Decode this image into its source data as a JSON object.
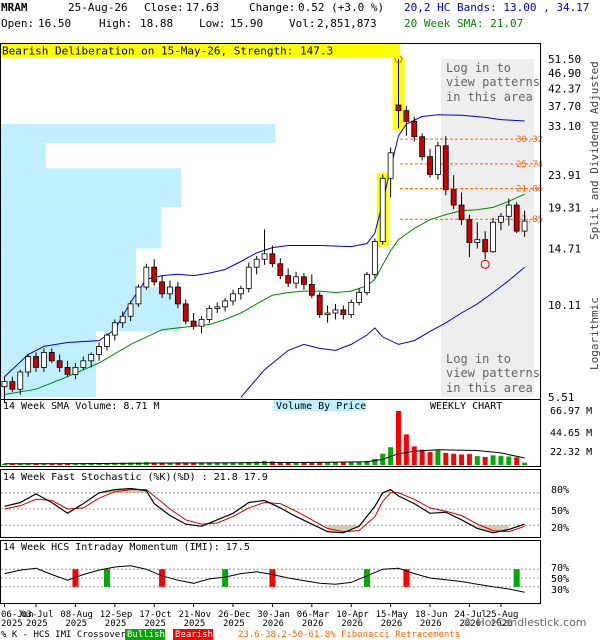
{
  "header": {
    "ticker": "MRAM",
    "date": "25-Aug-26",
    "close_label": "Close:",
    "close_value": "17.63",
    "change_label": "Change:",
    "change_value": "0.52 (+3.0 %)",
    "open_label": "Open:",
    "open_value": "16.50",
    "high_label": "High:",
    "high_value": "18.88",
    "low_label": "Low:",
    "low_value": "15.90",
    "vol_label": "Vol:",
    "vol_value": "2,851,873",
    "hc_bands_label": "20,2 HC Bands: 13.00 , 34.17",
    "sma_label": "20 Week SMA: 21.07"
  },
  "watermark": "© HotCandlestick.com",
  "price_panel": {
    "banner": "Bearish Deliberation on 15-May-26, Strength: 147.3",
    "login_text_top": [
      "Log in to",
      "view patterns",
      "in this area"
    ],
    "login_text_bottom": [
      "Log in to",
      "view patterns",
      "in this area"
    ],
    "y_axis_labels": [
      "51.50",
      "46.90",
      "42.37",
      "37.70",
      "33.10",
      "23.91",
      "19.31",
      "14.71",
      "10.11",
      "5.51"
    ],
    "fib_labels": [
      "30.32",
      "25.74",
      "21.86",
      "17.85"
    ],
    "side_label_top": "Split and Dividend Adjusted",
    "side_label_bottom": "Logarithmic"
  },
  "volume_panel": {
    "sma_label": "14 Week SMA Volume: 8.71 M",
    "vbp_label": "Volume By Price",
    "weekly_label": "WEEKLY CHART",
    "y_labels": [
      "66.97 M",
      "44.65 M",
      "22.32 M"
    ]
  },
  "stoch_panel": {
    "title": "14 Week Fast Stochastic (%K)(%D) : 21.8  17.9",
    "y_labels": [
      "80%",
      "50%",
      "20%"
    ]
  },
  "imi_panel": {
    "title": "14 Week HCS Intraday Momentum (IMI): 17.5",
    "y_labels": [
      "70%",
      "50%",
      "30%"
    ]
  },
  "x_axis": {
    "dates": [
      "06-Jun",
      "03-Jul",
      "08-Aug",
      "12-Sep",
      "17-Oct",
      "21-Nov",
      "26-Dec",
      "30-Jan",
      "06-Mar",
      "10-Apr",
      "15-May",
      "18-Jun",
      "24-Jul",
      "25-Aug"
    ],
    "years": [
      "2025",
      "2025",
      "2025",
      "2025",
      "2025",
      "2025",
      "2025",
      "2026",
      "2026",
      "2026",
      "2026",
      "2026",
      "2026",
      "2026"
    ]
  },
  "footer": {
    "legend_prefix": "% K - HCS IMI Crossover,",
    "bullish": "Bullish",
    "bearish": "Bearish",
    "fib_text": "23.6-38.2-50-61.8% Fibonacci Retracements"
  },
  "colors": {
    "bull": "#00aa00",
    "bear": "#ff0000",
    "upper_band": "#0000cc",
    "sma": "#008800",
    "fib": "#ff6600",
    "vbp": "#c0f0ff",
    "banner": "#ffff00"
  },
  "chart_data": {
    "type": "candlestick",
    "timeframe": "weekly",
    "scale": "log",
    "ylim": [
      5.51,
      51.5
    ],
    "candles": [
      [
        5.9,
        6.3,
        5.3,
        6.1
      ],
      [
        6.1,
        6.3,
        5.7,
        5.8
      ],
      [
        5.8,
        6.6,
        5.6,
        6.5
      ],
      [
        6.5,
        7.3,
        6.3,
        7.2
      ],
      [
        7.2,
        7.4,
        6.5,
        6.7
      ],
      [
        6.7,
        7.6,
        6.5,
        7.4
      ],
      [
        7.4,
        7.6,
        6.9,
        7.0
      ],
      [
        7.0,
        7.3,
        6.5,
        6.7
      ],
      [
        6.7,
        7.0,
        6.3,
        6.4
      ],
      [
        6.4,
        6.9,
        6.2,
        6.7
      ],
      [
        6.7,
        7.2,
        6.6,
        7.0
      ],
      [
        7.0,
        7.4,
        6.7,
        7.3
      ],
      [
        7.3,
        7.9,
        7.0,
        7.7
      ],
      [
        7.7,
        8.4,
        7.5,
        8.3
      ],
      [
        8.3,
        9.2,
        8.0,
        9.0
      ],
      [
        9.0,
        9.7,
        8.7,
        9.4
      ],
      [
        9.4,
        10.4,
        9.1,
        10.2
      ],
      [
        10.2,
        11.6,
        10.0,
        11.4
      ],
      [
        11.4,
        13.3,
        11.2,
        13.0
      ],
      [
        13.0,
        13.7,
        11.5,
        11.8
      ],
      [
        11.8,
        12.3,
        10.6,
        10.9
      ],
      [
        10.9,
        11.9,
        10.5,
        11.4
      ],
      [
        11.4,
        11.8,
        9.9,
        10.2
      ],
      [
        10.2,
        10.5,
        8.9,
        9.1
      ],
      [
        9.1,
        9.6,
        8.6,
        8.8
      ],
      [
        8.8,
        9.4,
        8.4,
        9.2
      ],
      [
        9.2,
        10.1,
        9.0,
        9.9
      ],
      [
        9.9,
        10.3,
        9.6,
        10.0
      ],
      [
        10.0,
        10.6,
        9.7,
        10.4
      ],
      [
        10.4,
        11.2,
        10.1,
        10.9
      ],
      [
        10.9,
        11.5,
        10.5,
        11.3
      ],
      [
        11.3,
        13.4,
        11.0,
        13.0
      ],
      [
        13.0,
        14.0,
        12.4,
        13.7
      ],
      [
        13.7,
        16.7,
        13.2,
        14.2
      ],
      [
        14.2,
        15.0,
        13.0,
        13.3
      ],
      [
        13.3,
        13.8,
        12.0,
        12.3
      ],
      [
        12.3,
        12.9,
        11.4,
        11.7
      ],
      [
        11.7,
        12.6,
        11.3,
        12.2
      ],
      [
        12.2,
        12.5,
        11.2,
        11.6
      ],
      [
        11.6,
        12.4,
        10.6,
        10.8
      ],
      [
        10.8,
        11.0,
        9.3,
        9.5
      ],
      [
        9.5,
        10.1,
        9.0,
        9.6
      ],
      [
        9.6,
        10.2,
        9.2,
        9.8
      ],
      [
        9.8,
        10.1,
        9.2,
        9.5
      ],
      [
        9.5,
        10.5,
        9.3,
        10.3
      ],
      [
        10.3,
        11.3,
        10.1,
        11.0
      ],
      [
        11.0,
        12.6,
        10.8,
        12.4
      ],
      [
        12.4,
        15.7,
        12.1,
        15.4
      ],
      [
        15.4,
        24.0,
        15.1,
        23.4
      ],
      [
        23.4,
        28.7,
        20.6,
        27.7
      ],
      [
        38.0,
        51.5,
        32.6,
        36.6
      ],
      [
        36.6,
        37.7,
        31.0,
        34.1
      ],
      [
        34.1,
        35.1,
        29.8,
        30.8
      ],
      [
        30.8,
        31.5,
        26.3,
        27.0
      ],
      [
        27.0,
        28.4,
        23.5,
        24.0
      ],
      [
        24.0,
        29.8,
        23.2,
        29.0
      ],
      [
        29.0,
        30.9,
        20.9,
        21.7
      ],
      [
        21.7,
        23.9,
        19.1,
        19.6
      ],
      [
        19.6,
        21.3,
        17.2,
        17.8
      ],
      [
        17.8,
        18.4,
        13.9,
        15.3
      ],
      [
        15.3,
        17.5,
        14.7,
        15.6
      ],
      [
        15.6,
        16.5,
        13.7,
        14.4
      ],
      [
        14.4,
        18.0,
        14.3,
        17.5
      ],
      [
        17.5,
        18.6,
        16.6,
        18.2
      ],
      [
        18.2,
        20.5,
        17.1,
        19.6
      ],
      [
        19.6,
        20.0,
        16.3,
        16.5
      ],
      [
        16.5,
        18.88,
        15.9,
        17.63
      ]
    ],
    "upper_band": [
      [
        0,
        6.3
      ],
      [
        3,
        7.3
      ],
      [
        5,
        7.7
      ],
      [
        8,
        7.9
      ],
      [
        12,
        8.0
      ],
      [
        14,
        8.6
      ],
      [
        16,
        10.3
      ],
      [
        18,
        12.0
      ],
      [
        20,
        12.3
      ],
      [
        22,
        12.4
      ],
      [
        24,
        12.3
      ],
      [
        26,
        12.5
      ],
      [
        28,
        12.8
      ],
      [
        30,
        13.5
      ],
      [
        32,
        14.3
      ],
      [
        34,
        14.8
      ],
      [
        36,
        15.0
      ],
      [
        40,
        15.0
      ],
      [
        44,
        14.9
      ],
      [
        46,
        15.2
      ],
      [
        47,
        16.3
      ],
      [
        48,
        20.0
      ],
      [
        49,
        25.0
      ],
      [
        50,
        31.0
      ],
      [
        51,
        33.5
      ],
      [
        53,
        35.2
      ],
      [
        55,
        35.6
      ],
      [
        58,
        35.5
      ],
      [
        61,
        35.0
      ],
      [
        63,
        34.5
      ],
      [
        66,
        34.17
      ]
    ],
    "lower_band": [
      [
        30,
        5.5
      ],
      [
        33,
        6.6
      ],
      [
        36,
        7.5
      ],
      [
        38,
        7.8
      ],
      [
        40,
        7.6
      ],
      [
        42,
        7.5
      ],
      [
        44,
        7.8
      ],
      [
        46,
        8.3
      ],
      [
        47,
        8.7
      ],
      [
        48,
        8.2
      ],
      [
        50,
        7.8
      ],
      [
        52,
        8.0
      ],
      [
        54,
        8.5
      ],
      [
        56,
        9.0
      ],
      [
        58,
        9.6
      ],
      [
        60,
        10.2
      ],
      [
        62,
        11.0
      ],
      [
        64,
        11.9
      ],
      [
        66,
        13.0
      ]
    ],
    "sma20": [
      [
        0,
        5.6
      ],
      [
        4,
        5.8
      ],
      [
        8,
        6.3
      ],
      [
        12,
        6.9
      ],
      [
        16,
        7.8
      ],
      [
        20,
        8.6
      ],
      [
        22,
        8.7
      ],
      [
        24,
        8.8
      ],
      [
        26,
        8.9
      ],
      [
        28,
        9.2
      ],
      [
        30,
        9.6
      ],
      [
        32,
        10.2
      ],
      [
        34,
        10.8
      ],
      [
        36,
        11.0
      ],
      [
        38,
        11.1
      ],
      [
        40,
        11.1
      ],
      [
        42,
        11.0
      ],
      [
        44,
        11.1
      ],
      [
        46,
        11.5
      ],
      [
        47,
        12.0
      ],
      [
        48,
        13.2
      ],
      [
        49,
        14.5
      ],
      [
        50,
        15.6
      ],
      [
        52,
        16.8
      ],
      [
        54,
        17.8
      ],
      [
        56,
        18.4
      ],
      [
        58,
        18.9
      ],
      [
        60,
        19.0
      ],
      [
        62,
        19.3
      ],
      [
        64,
        20.1
      ],
      [
        66,
        21.07
      ]
    ],
    "fib_levels": [
      30.32,
      25.74,
      21.86,
      17.85
    ],
    "volume_m": [
      1.5,
      1.4,
      1.6,
      1.8,
      1.6,
      1.7,
      1.6,
      1.5,
      1.5,
      1.6,
      1.7,
      1.8,
      2.0,
      2.2,
      2.5,
      2.6,
      2.7,
      3.0,
      3.5,
      3.0,
      2.8,
      2.7,
      2.6,
      2.7,
      2.5,
      2.4,
      2.5,
      2.6,
      2.7,
      2.8,
      2.9,
      3.5,
      4.2,
      5.0,
      4.4,
      3.8,
      3.4,
      3.2,
      3.0,
      3.0,
      3.2,
      2.9,
      3.0,
      3.0,
      3.1,
      3.4,
      5.0,
      7.5,
      14.0,
      22.0,
      66.97,
      38.0,
      23.0,
      19.0,
      16.0,
      18.0,
      15.0,
      14.0,
      13.0,
      13.5,
      11.0,
      10.0,
      12.0,
      11.0,
      10.5,
      9.5,
      2.85
    ],
    "volume_sma": [
      [
        0,
        1.6
      ],
      [
        10,
        1.7
      ],
      [
        20,
        2.5
      ],
      [
        30,
        2.9
      ],
      [
        40,
        3.2
      ],
      [
        46,
        4.0
      ],
      [
        48,
        7.0
      ],
      [
        50,
        14.0
      ],
      [
        52,
        17.0
      ],
      [
        55,
        19.0
      ],
      [
        60,
        18.0
      ],
      [
        63,
        15.0
      ],
      [
        66,
        8.71
      ]
    ],
    "stoch_k": [
      [
        0,
        55
      ],
      [
        2,
        62
      ],
      [
        4,
        78
      ],
      [
        6,
        62
      ],
      [
        8,
        42
      ],
      [
        10,
        60
      ],
      [
        12,
        80
      ],
      [
        14,
        86
      ],
      [
        16,
        88
      ],
      [
        18,
        84
      ],
      [
        19,
        60
      ],
      [
        21,
        38
      ],
      [
        23,
        22
      ],
      [
        25,
        18
      ],
      [
        27,
        30
      ],
      [
        29,
        42
      ],
      [
        31,
        62
      ],
      [
        33,
        66
      ],
      [
        35,
        52
      ],
      [
        37,
        36
      ],
      [
        39,
        22
      ],
      [
        41,
        8
      ],
      [
        43,
        6
      ],
      [
        45,
        18
      ],
      [
        47,
        55
      ],
      [
        48,
        80
      ],
      [
        49,
        86
      ],
      [
        50,
        74
      ],
      [
        52,
        60
      ],
      [
        54,
        42
      ],
      [
        56,
        44
      ],
      [
        58,
        30
      ],
      [
        60,
        14
      ],
      [
        62,
        6
      ],
      [
        64,
        12
      ],
      [
        66,
        21.8
      ]
    ],
    "stoch_d": [
      [
        0,
        50
      ],
      [
        2,
        56
      ],
      [
        4,
        68
      ],
      [
        6,
        66
      ],
      [
        8,
        50
      ],
      [
        10,
        52
      ],
      [
        12,
        70
      ],
      [
        14,
        82
      ],
      [
        16,
        86
      ],
      [
        18,
        86
      ],
      [
        19,
        74
      ],
      [
        21,
        50
      ],
      [
        23,
        30
      ],
      [
        25,
        22
      ],
      [
        27,
        24
      ],
      [
        29,
        36
      ],
      [
        31,
        52
      ],
      [
        33,
        62
      ],
      [
        35,
        60
      ],
      [
        37,
        46
      ],
      [
        39,
        30
      ],
      [
        41,
        14
      ],
      [
        43,
        8
      ],
      [
        45,
        10
      ],
      [
        47,
        36
      ],
      [
        48,
        64
      ],
      [
        49,
        80
      ],
      [
        50,
        80
      ],
      [
        52,
        68
      ],
      [
        54,
        52
      ],
      [
        56,
        46
      ],
      [
        58,
        38
      ],
      [
        60,
        22
      ],
      [
        62,
        10
      ],
      [
        64,
        8
      ],
      [
        66,
        17.9
      ]
    ],
    "imi": [
      [
        0,
        60
      ],
      [
        2,
        68
      ],
      [
        4,
        72
      ],
      [
        6,
        58
      ],
      [
        8,
        45
      ],
      [
        10,
        58
      ],
      [
        12,
        68
      ],
      [
        14,
        75
      ],
      [
        16,
        78
      ],
      [
        18,
        70
      ],
      [
        20,
        55
      ],
      [
        22,
        45
      ],
      [
        24,
        38
      ],
      [
        26,
        48
      ],
      [
        28,
        52
      ],
      [
        30,
        60
      ],
      [
        32,
        64
      ],
      [
        34,
        58
      ],
      [
        36,
        50
      ],
      [
        38,
        44
      ],
      [
        40,
        38
      ],
      [
        42,
        36
      ],
      [
        44,
        40
      ],
      [
        46,
        55
      ],
      [
        48,
        70
      ],
      [
        50,
        72
      ],
      [
        52,
        60
      ],
      [
        54,
        50
      ],
      [
        56,
        46
      ],
      [
        58,
        42
      ],
      [
        60,
        36
      ],
      [
        62,
        30
      ],
      [
        64,
        25
      ],
      [
        66,
        17.5
      ]
    ],
    "crossovers": [
      {
        "idx": 9,
        "type": "bearish"
      },
      {
        "idx": 13,
        "type": "bullish"
      },
      {
        "idx": 20,
        "type": "bearish"
      },
      {
        "idx": 28,
        "type": "bullish"
      },
      {
        "idx": 34,
        "type": "bearish"
      },
      {
        "idx": 46,
        "type": "bullish"
      },
      {
        "idx": 51,
        "type": "bearish"
      },
      {
        "idx": 65,
        "type": "bullish"
      }
    ],
    "highlight_candles": [
      48,
      50
    ],
    "hammer_marker": 61
  }
}
